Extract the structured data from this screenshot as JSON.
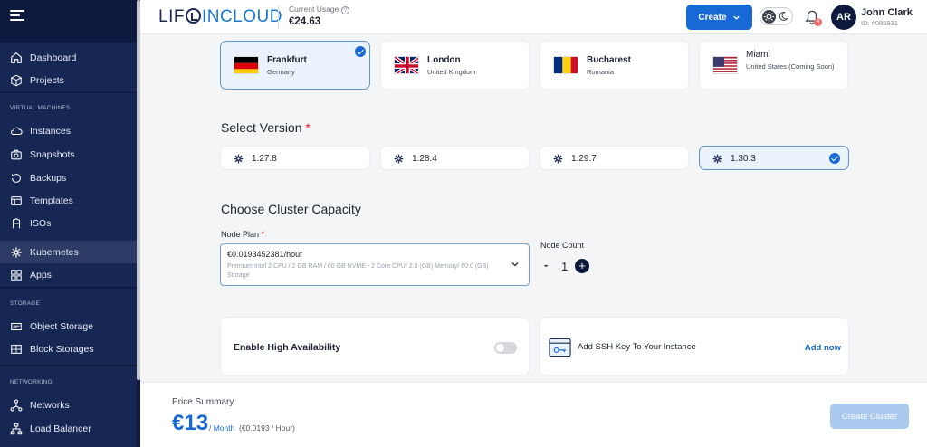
{
  "sidebar": {
    "items": [
      {
        "label": "Dashboard"
      },
      {
        "label": "Projects"
      },
      {
        "label": "Instances"
      },
      {
        "label": "Snapshots"
      },
      {
        "label": "Backups"
      },
      {
        "label": "Templates"
      },
      {
        "label": "ISOs"
      },
      {
        "label": "Kubernetes"
      },
      {
        "label": "Apps"
      },
      {
        "label": "Object Storage"
      },
      {
        "label": "Block Storages"
      },
      {
        "label": "Networks"
      },
      {
        "label": "Load Balancer"
      }
    ],
    "sections": {
      "virtual_machines": "VIRTUAL MACHINES",
      "storage": "STORAGE",
      "networking": "NETWORKING"
    },
    "active": "Kubernetes"
  },
  "header": {
    "logo_a": "LIF",
    "logo_b": "INCLOUD",
    "usage_label": "Current Usage",
    "usage_value": "€24.63",
    "create_label": "Create",
    "notification_count": "4",
    "avatar_initials": "AR",
    "user_name": "John Clark",
    "user_id": "ID: #085931"
  },
  "locations": [
    {
      "name": "Frankfurt",
      "country": "Germany",
      "selected": true
    },
    {
      "name": "London",
      "country": "United Kingdom",
      "selected": false
    },
    {
      "name": "Bucharest",
      "country": "Romania",
      "selected": false
    },
    {
      "name": "Miami",
      "country": "United States (Coming Soon)",
      "selected": false
    }
  ],
  "version": {
    "title": "Select Version",
    "required": "*",
    "options": [
      "1.27.8",
      "1.28.4",
      "1.29.7",
      "1.30.3"
    ],
    "selected": "1.30.3"
  },
  "capacity": {
    "title": "Choose Cluster Capacity",
    "node_plan_label": "Node Plan",
    "required": "*",
    "node_plan_price": "€0.0193452381/hour",
    "node_plan_desc": "Premium Intel 2 CPU / 2 GB RAM / 60 GB NVME - 2 Core CPU/ 2.0 (GB) Memory/ 60.0 (GB) Storage",
    "node_count_label": "Node Count",
    "node_count_minus": "-",
    "node_count": "1",
    "node_count_plus": "+"
  },
  "options": {
    "ha_label": "Enable High Availability",
    "ha_enabled": false,
    "ssh_label": "Add SSH Key To Your Instance",
    "ssh_action": "Add now"
  },
  "footer": {
    "price_summary_label": "Price Summary",
    "price_month": "€13",
    "per_month": "/ Month",
    "per_hour": "(€0.0193 / Hour)",
    "create_cluster": "Create Cluster"
  },
  "colors": {
    "sidebar_bg": "#0e1a3d",
    "accent": "#1769d6",
    "disabled_button": "#a9c9ee"
  }
}
